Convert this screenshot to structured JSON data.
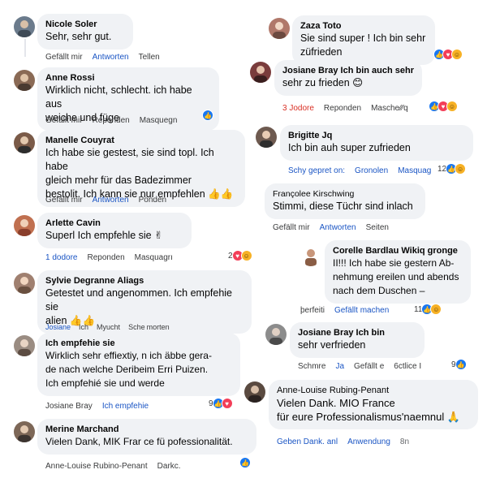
{
  "colors": {
    "link": "#1a55c4",
    "bubble": "#f0f2f5",
    "like": "#1877f2",
    "love": "#f33e58",
    "haha": "#f7b125"
  },
  "left": [
    {
      "name": "Nicole Soler",
      "text": "Sehr, sehr gut.",
      "actions": [
        "Gefällt mir",
        "Antworten",
        "Tellen"
      ],
      "avatar": "#6b7b8c"
    },
    {
      "name": "Anne Rossi",
      "text": "Wirklich nicht, schlecht. ich habe aus\nweiche und füge",
      "actions": [
        "Gefällt mir",
        "Reponden",
        "Masquegn"
      ],
      "avatar": "#8a6a55"
    },
    {
      "name": "Manelle Couyrat",
      "text": "Ich habe sie gestest, sie sind topl. Ich habe\ngleich mehr für das Badezimmer\nbestolit. Ich kann sie nur empfehlen 👍👍",
      "actions": [
        "Gefällt mir",
        "Antworten",
        "Ponden"
      ],
      "avatar": "#7a5a48"
    },
    {
      "name": "Arlette Cavin",
      "text": "Superl Ich empfehle sie ✌",
      "actions": [
        "1 dodore",
        "Reponden",
        "Masquagrı"
      ],
      "react_count": "2",
      "avatar": "#c07050"
    },
    {
      "name": "Sylvie Degranne Aliags",
      "text": "Getestet und angenommen. Ich empfehie sie\nalien 👍👍",
      "actions": [
        "Josiane",
        "Ich",
        "Myucht",
        "Sche",
        "morten"
      ],
      "avatar": "#a08070"
    },
    {
      "name": "Ich empfehie sie",
      "text": "Wirklich sehr effiextiy, n ich äbbe gera-\nde nach welche Deribeim Erri Puizen.\nIch empfehié sie und werde",
      "actions": [
        "Josiane Bray",
        "Ich empfehie"
      ],
      "react_count": "9",
      "avatar": "#9a8c82"
    },
    {
      "name": "Merine Marchand",
      "text": "Vielen Dank, MIK Frar ce fü pofessionalität.",
      "actions": [
        "Anne-Louise Rubino-Penant",
        "Darkc."
      ],
      "avatar": "#7d6757"
    }
  ],
  "right": [
    {
      "name": "Zaza Toto",
      "text": "Sie sind super ! Ich bin sehr\nzüfrieden",
      "avatar": "#b0786a"
    },
    {
      "name": "Josiane Bray    Ich bin auch sehr",
      "text": "sehr zu frieden 😊",
      "actions": [
        "3 Jodore",
        "Reponden",
        "Masche⁄∕∕q"
      ],
      "avatar": "#7a3c3c"
    },
    {
      "name": "Brigitte Jq",
      "text": "Ich bin auh super zufrieden",
      "actions": [
        "Schy gepret on:",
        "Gronolen",
        "Masquag"
      ],
      "react_count": "12",
      "avatar": "#6e5a50"
    },
    {
      "name": "Françolee Kirschwing",
      "text": "Stimmi, diese Tüchr sind inlach",
      "actions": [
        "Gefällt mir",
        "Antworten",
        "Seiten"
      ],
      "avatar": ""
    },
    {
      "name": "Corelle Bardlau    Wikiq gronge",
      "text": "II!!! Ich habe sie gestern Ab-\nnehmung ereilen und abends\nnach dem Duschen –",
      "actions": [
        "þerfeiti",
        "Gefällt machen"
      ],
      "react_count": "11",
      "avatar": "#8a5d45"
    },
    {
      "name": "Josiane Bray    Ich bin",
      "text": "sehr verfrieden",
      "actions": [
        "Schmre",
        "Ja",
        "Gefällt e",
        "6ctlice I"
      ],
      "react_count": "9",
      "avatar": "#8c8c8c"
    },
    {
      "name": "Anne-Louise Rubing-Penant",
      "text": "Vielen Dank. MIO France\nfür eure Professionalismus'naemnul 🙏",
      "actions": [
        "Geben Dank. anl",
        "Anwendung",
        "8n"
      ],
      "avatar": "#5a4a40"
    }
  ]
}
